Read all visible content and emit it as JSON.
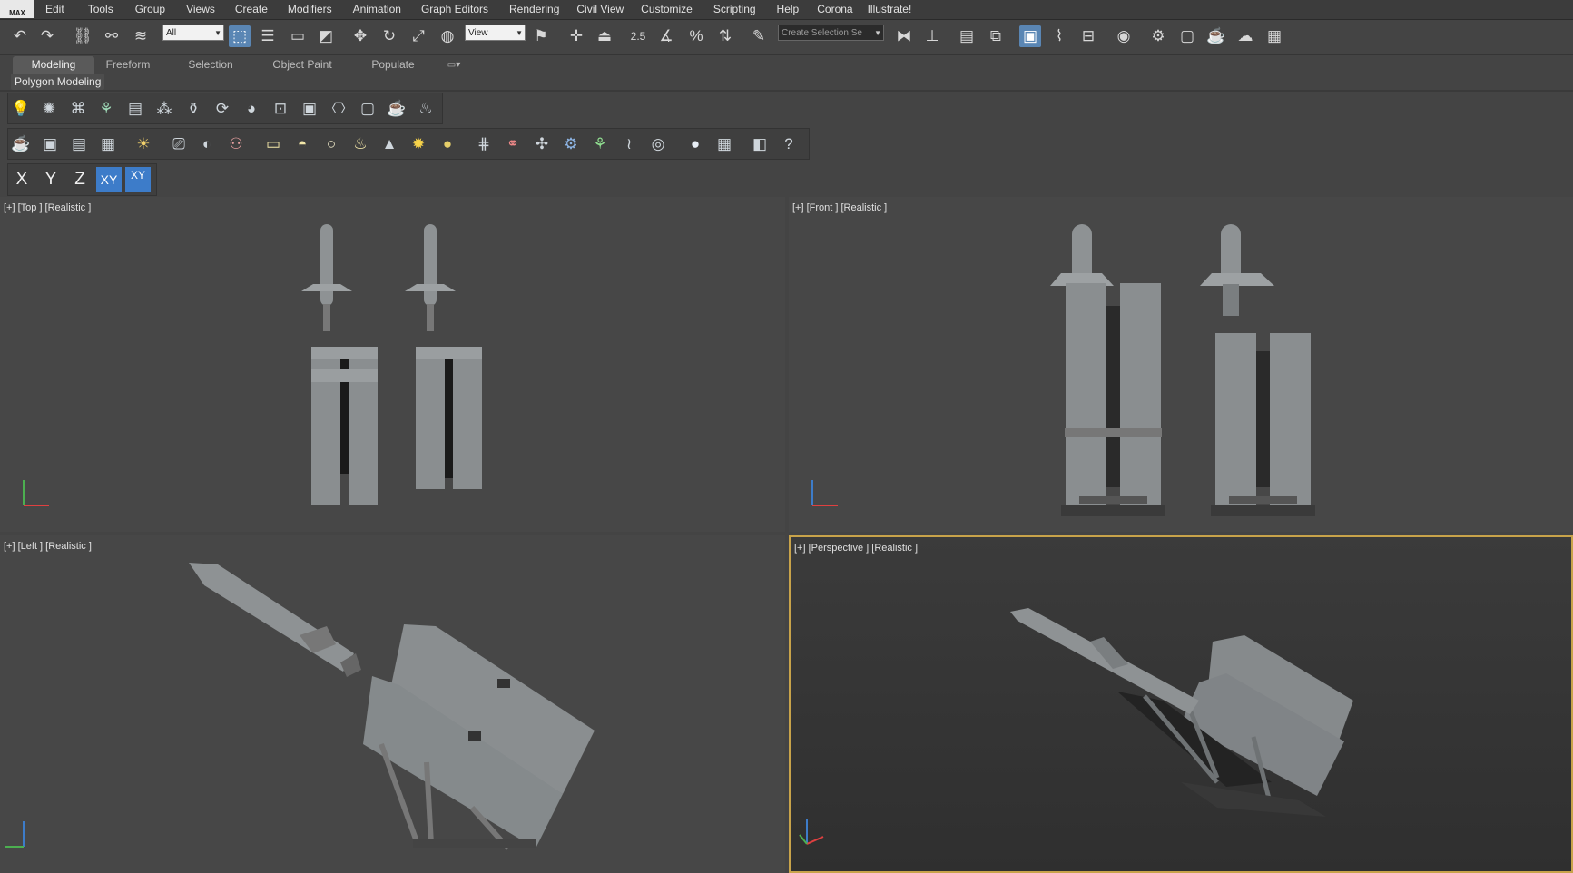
{
  "app": {
    "logo_text": "MAX"
  },
  "menu": [
    "Edit",
    "Tools",
    "Group",
    "Views",
    "Create",
    "Modifiers",
    "Animation",
    "Graph Editors",
    "Rendering",
    "Civil View",
    "Customize",
    "Scripting",
    "Help",
    "Corona",
    "Illustrate!"
  ],
  "toolbar": {
    "selection_filter": "All",
    "reference_coord": "View",
    "snap_value": "2.5",
    "named_selection_placeholder": "Create Selection Se"
  },
  "ribbon": {
    "tabs": [
      "Modeling",
      "Freeform",
      "Selection",
      "Object Paint",
      "Populate"
    ],
    "active_tab": "Modeling",
    "panel_label": "Polygon Modeling"
  },
  "axis_constraints": {
    "x": "X",
    "y": "Y",
    "z": "Z",
    "xy": "XY",
    "xy_lock": "XY"
  },
  "viewports": {
    "top": {
      "label": "[+] [Top ] [Realistic ]"
    },
    "front": {
      "label": "[+] [Front ] [Realistic ]"
    },
    "left": {
      "label": "[+] [Left ] [Realistic ]"
    },
    "perspective": {
      "label": "[+] [Perspective ] [Realistic ]"
    }
  },
  "colors": {
    "accent": "#3d7cc9",
    "active_viewport_border": "#c8a34a",
    "viewport_bg": "#474747",
    "model_gray": "#8e9294"
  }
}
